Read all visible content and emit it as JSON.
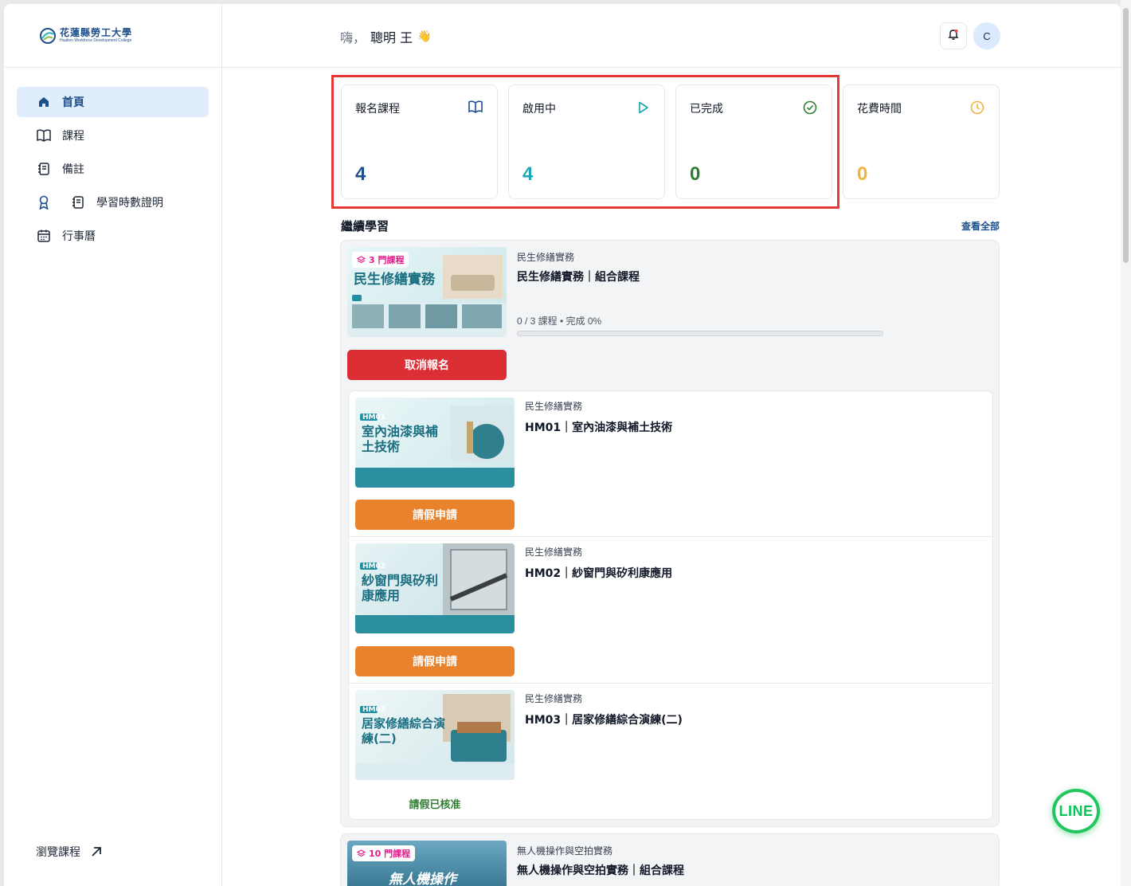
{
  "brand": {
    "name_zh": "花蓮縣勞工大學",
    "name_en": "Hualien Workforce Development College"
  },
  "sidebar": {
    "items": [
      {
        "label": "首頁",
        "icon": "home-icon",
        "active": true
      },
      {
        "label": "課程",
        "icon": "book-icon",
        "active": false
      },
      {
        "label": "備註",
        "icon": "notebook-icon",
        "active": false
      },
      {
        "label": "學習時數證明",
        "icon": "award-icon",
        "active": false
      },
      {
        "label": "行事曆",
        "icon": "calendar-icon",
        "active": false
      }
    ],
    "browse_label": "瀏覽課程"
  },
  "header": {
    "greeting": "嗨，",
    "user_name": "聰明 王",
    "wave": "👋",
    "avatar_initial": "C"
  },
  "stats": [
    {
      "label": "報名課程",
      "value": "4",
      "icon": "book-open-icon",
      "color": "#1e4f8a"
    },
    {
      "label": "啟用中",
      "value": "4",
      "icon": "play-icon",
      "color": "#1fa6b8"
    },
    {
      "label": "已完成",
      "value": "0",
      "icon": "check-circle-icon",
      "color": "#2f7d32"
    },
    {
      "label": "花費時間",
      "value": "0",
      "icon": "clock-icon",
      "color": "#f0b43c"
    }
  ],
  "continue": {
    "title": "繼續學習",
    "view_all": "查看全部"
  },
  "bundles": [
    {
      "badge": "3 門課程",
      "thumb_text": "民生修繕實務",
      "category": "民生修繕實務",
      "title": "民生修繕實務｜組合課程",
      "progress_text": "0 / 3 課程 • 完成 0%",
      "progress": 0,
      "action": "取消報名",
      "courses": [
        {
          "thumb_text": "室內油漆與補土技術",
          "thumb_code": "HM01",
          "category": "民生修繕實務",
          "title": "HM01｜室內油漆與補土技術",
          "action": "請假申請"
        },
        {
          "thumb_text": "紗窗門與矽利康應用",
          "thumb_code": "HM02",
          "category": "民生修繕實務",
          "title": "HM02｜紗窗門與矽利康應用",
          "action": "請假申請"
        },
        {
          "thumb_text": "居家修繕綜合演練(二)",
          "thumb_code": "HM03",
          "category": "民生修繕實務",
          "title": "HM03｜居家修繕綜合演練(二)",
          "status": "請假已核准"
        }
      ]
    },
    {
      "badge": "10 門課程",
      "thumb_text": "無人機操作",
      "category": "無人機操作與空拍實務",
      "title": "無人機操作與空拍實務｜組合課程"
    }
  ],
  "fab": {
    "label": "LINE"
  }
}
